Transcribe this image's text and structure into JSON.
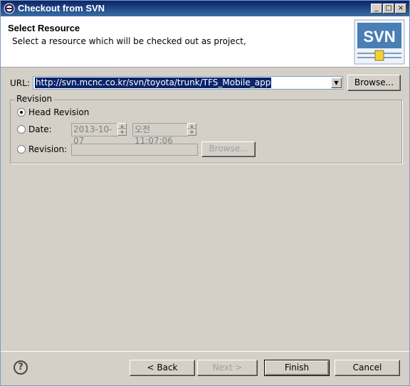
{
  "window": {
    "title": "Checkout from SVN",
    "min_symbol": "_",
    "max_symbol": "□",
    "close_symbol": "×"
  },
  "header": {
    "title": "Select Resource",
    "description": "Select a resource which will be checked out as project,",
    "logo_text": "SVN"
  },
  "url": {
    "label": "URL:",
    "value": "http://svn.mcnc.co.kr/svn/toyota/trunk/TFS_Mobile_app",
    "browse_label": "Browse..."
  },
  "revision": {
    "group_label": "Revision",
    "head_label": "Head Revision",
    "date_label": "Date:",
    "date_value": "2013-10-07",
    "time_value": "오전 11:07:06",
    "revision_label": "Revision:",
    "revision_value": "",
    "browse_label": "Browse...",
    "selected": "head"
  },
  "footer": {
    "help_symbol": "?",
    "back_label": "< Back",
    "next_label": "Next >",
    "finish_label": "Finish",
    "cancel_label": "Cancel"
  },
  "colors": {
    "titlebar": "#0a246a",
    "selection": "#0a246a",
    "dialog_bg": "#d4d0c8",
    "svn_logo": "#4a7fb5"
  }
}
